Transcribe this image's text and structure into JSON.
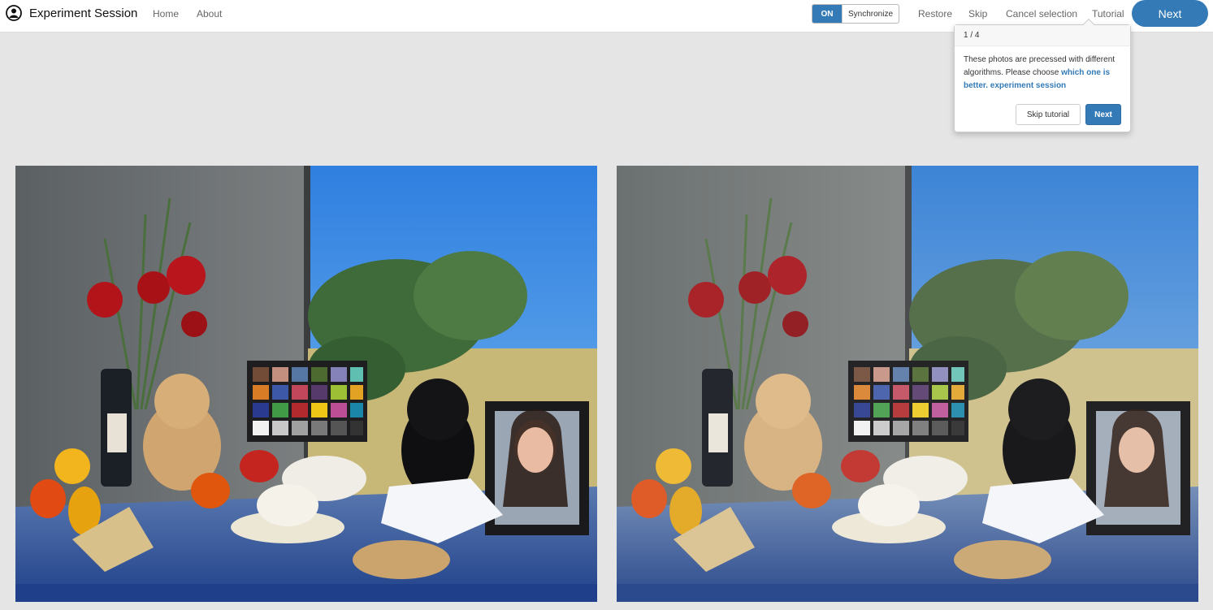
{
  "header": {
    "title": "Experiment Session",
    "nav": {
      "home": "Home",
      "about": "About"
    },
    "sync": {
      "state": "ON",
      "label": "Synchronize"
    },
    "actions": {
      "restore": "Restore",
      "skip": "Skip",
      "cancel": "Cancel selection",
      "tutorial": "Tutorial"
    },
    "next_label": "Next"
  },
  "tutorial": {
    "step": "1 / 4",
    "text_plain": "These photos are precessed with different algorithms. Please choose",
    "text_emphasis": "which one is better. experiment session",
    "skip_label": "Skip tutorial",
    "next_label": "Next"
  },
  "colors": {
    "accent": "#337ab7",
    "background": "#e5e5e5"
  },
  "photos": [
    {
      "name": "photo-option-a"
    },
    {
      "name": "photo-option-b"
    }
  ]
}
